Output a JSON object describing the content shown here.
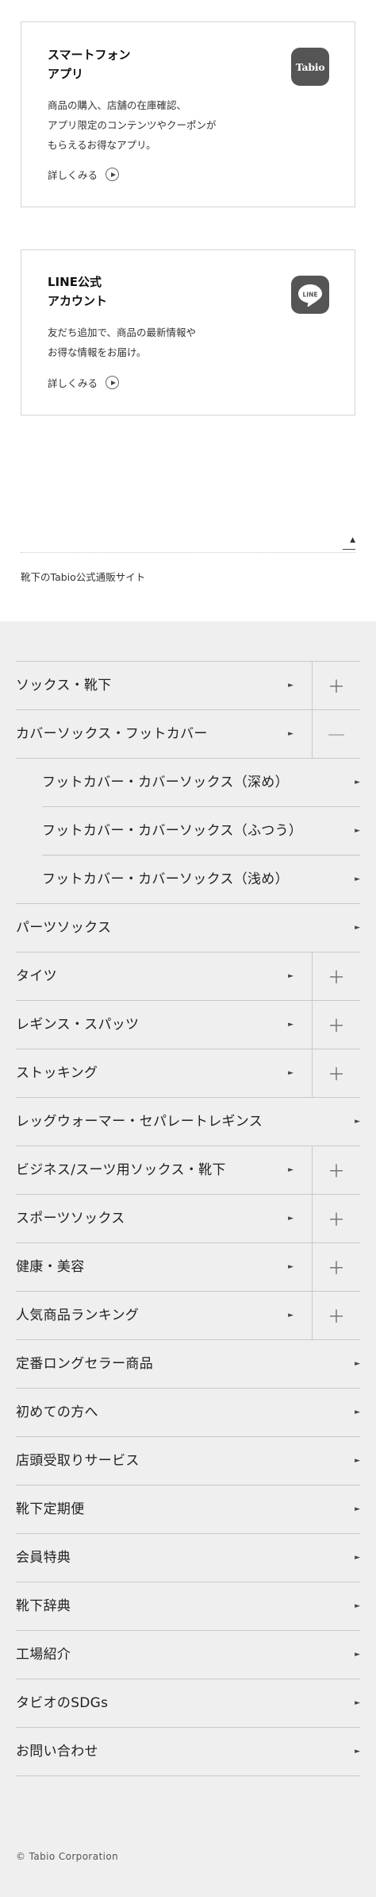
{
  "cards": {
    "app": {
      "title": "スマートフォン\nアプリ",
      "description": "商品の購入、店舗の在庫確認、\nアプリ限定のコンテンツやクーポンが\nもらえるお得なアプリ。",
      "more": "詳しくみる",
      "icon_text": "Tabio",
      "icon": "tabio-app-icon"
    },
    "line": {
      "title": "LINE公式\nアカウント",
      "description": "友だち追加で、商品の最新情報や\nお得な情報をお届け。",
      "more": "詳しくみる",
      "icon_text": "LINE",
      "icon": "line-icon"
    }
  },
  "page_top": {
    "arrow": "▲"
  },
  "site_title": "靴下のTabio公式通販サイト",
  "menu": [
    {
      "label": "ソックス・靴下",
      "toggle": "＋"
    },
    {
      "label": "カバーソックス・フットカバー",
      "toggle": "—"
    },
    {
      "label": "フットカバー・カバーソックス（深め）"
    },
    {
      "label": "フットカバー・カバーソックス（ふつう）"
    },
    {
      "label": "フットカバー・カバーソックス（浅め）"
    },
    {
      "label": "パーツソックス"
    },
    {
      "label": "タイツ",
      "toggle": "＋"
    },
    {
      "label": "レギンス・スパッツ",
      "toggle": "＋"
    },
    {
      "label": "ストッキング",
      "toggle": "＋"
    },
    {
      "label": "レッグウォーマー・セパレートレギンス"
    },
    {
      "label": "ビジネス/スーツ用ソックス・靴下",
      "toggle": "＋"
    },
    {
      "label": "スポーツソックス",
      "toggle": "＋"
    },
    {
      "label": "健康・美容",
      "toggle": "＋"
    },
    {
      "label": "人気商品ランキング",
      "toggle": "＋"
    },
    {
      "label": "定番ロングセラー商品"
    },
    {
      "label": "初めての方へ"
    },
    {
      "label": "店頭受取りサービス"
    },
    {
      "label": "靴下定期便"
    },
    {
      "label": "会員特典"
    },
    {
      "label": "靴下辞典"
    },
    {
      "label": "工場紹介"
    },
    {
      "label": "タビオのSDGs"
    },
    {
      "label": "お問い合わせ"
    }
  ],
  "menu_arrow": "►",
  "copyright": "© Tabio Corporation",
  "colors": {
    "footer_bg": "#efefef",
    "icon_bg": "#555555",
    "border": "#c8c8c8"
  }
}
